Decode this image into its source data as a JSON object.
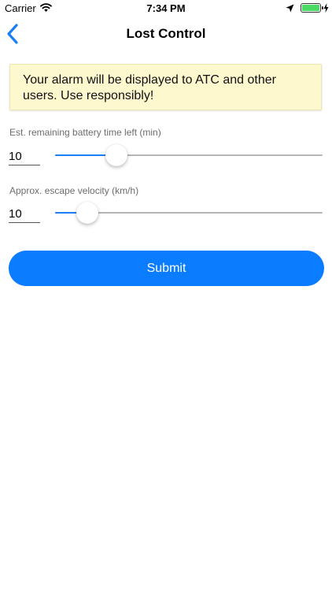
{
  "status_bar": {
    "carrier": "Carrier",
    "time": "7:34 PM",
    "icons": [
      "wifi-icon",
      "location-icon",
      "battery-icon",
      "charging-bolt-icon"
    ]
  },
  "nav": {
    "title": "Lost Control",
    "back_icon": "chevron-left-icon"
  },
  "warning": {
    "text": "Your alarm will be displayed to ATC and other users. Use responsibly!"
  },
  "battery_field": {
    "label": "Est. remaining battery time left (min)",
    "value": "10",
    "slider_fraction": 0.23
  },
  "velocity_field": {
    "label": "Approx. escape velocity (km/h)",
    "value": "10",
    "slider_fraction": 0.12
  },
  "submit": {
    "label": "Submit"
  },
  "colors": {
    "accent": "#0a7cff",
    "slider_fill": "#1a7ff5",
    "warning_bg": "#fdf8cd",
    "back_chevron": "#1a7ff5",
    "battery": "#4cd964"
  }
}
